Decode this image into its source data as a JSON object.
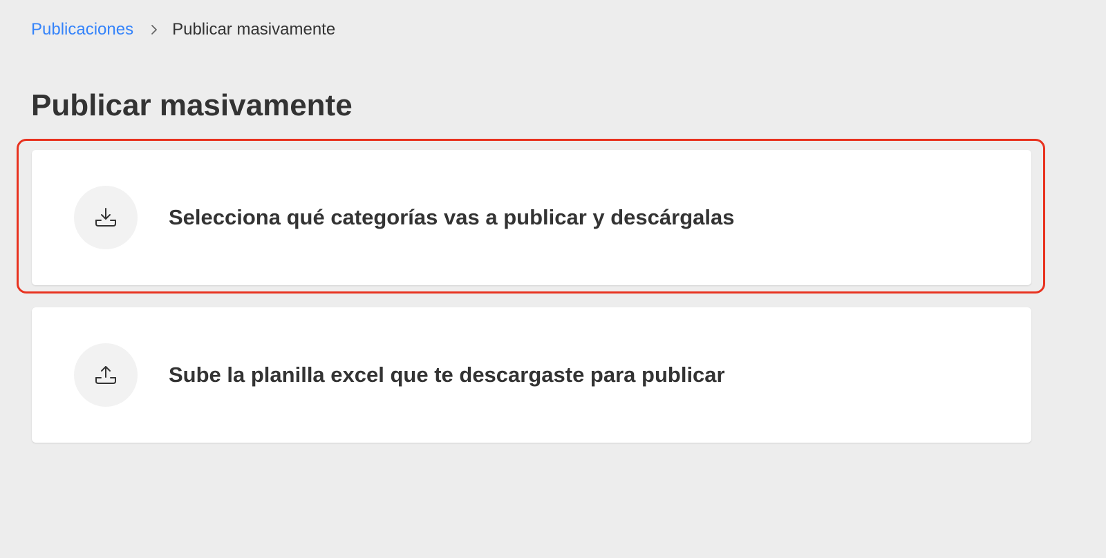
{
  "breadcrumb": {
    "parent_label": "Publicaciones",
    "current_label": "Publicar masivamente",
    "separator_icon": "chevron-right-icon"
  },
  "page": {
    "title": "Publicar masivamente"
  },
  "cards": [
    {
      "label": "Selecciona qué categorías vas a publicar y descárgalas",
      "icon": "download-icon",
      "highlighted": true
    },
    {
      "label": "Sube la planilla excel que te descargaste para publicar",
      "icon": "upload-icon",
      "highlighted": false
    }
  ],
  "colors": {
    "background": "#ededed",
    "link": "#3483fa",
    "text": "#333333",
    "card": "#ffffff",
    "icon_circle": "#f2f2f2",
    "highlight": "#e8321f"
  }
}
